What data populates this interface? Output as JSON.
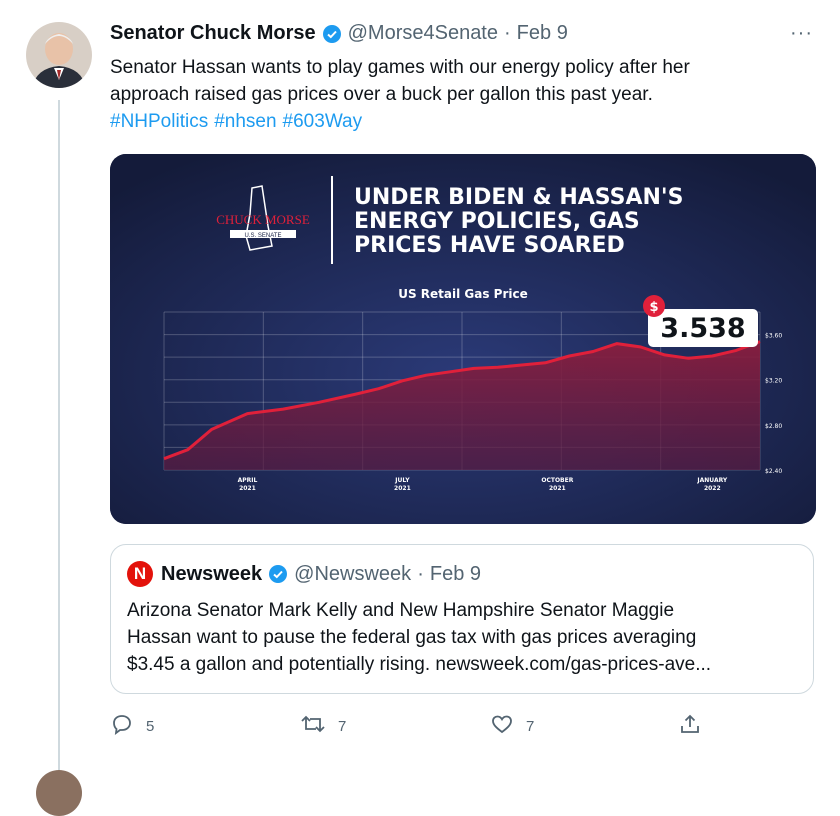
{
  "tweet": {
    "author_name": "Senator Chuck Morse",
    "handle": "@Morse4Senate",
    "separator": "·",
    "date": "Feb 9",
    "more_label": "···",
    "text_line1": "Senator Hassan wants to play games with our energy policy after her",
    "text_line2": "approach raised gas prices over a buck per gallon this past year.",
    "hashtags": [
      "#NHPolitics",
      "#nhsen",
      "#603Way"
    ]
  },
  "graphic": {
    "logo_name": "CHUCK MORSE",
    "logo_sub": "U.S. SENATE",
    "headline_line1": "UNDER BIDEN & HASSAN'S",
    "headline_line2": "ENERGY POLICIES, GAS",
    "headline_line3": "PRICES HAVE SOARED",
    "chart_title": "US Retail Gas Price",
    "callout_symbol": "$",
    "callout_value": "3.538",
    "colors": {
      "background": "#1a2346",
      "line": "#e0203a",
      "fill": "#7a1a3c",
      "headline": "#ffffff"
    }
  },
  "chart_data": {
    "type": "area",
    "title": "US Retail Gas Price",
    "xlabel": "",
    "ylabel": "",
    "x_ticks": [
      {
        "label": "APRIL",
        "sub": "2021"
      },
      {
        "label": "JULY",
        "sub": "2021"
      },
      {
        "label": "OCTOBER",
        "sub": "2021"
      },
      {
        "label": "JANUARY",
        "sub": "2022"
      }
    ],
    "y_ticks": [
      "$3.60",
      "$3.20",
      "$2.80",
      "$2.40"
    ],
    "ylim": [
      2.4,
      3.8
    ],
    "grid": true,
    "x": [
      0,
      4,
      8,
      14,
      20,
      26,
      32,
      36,
      40,
      44,
      48,
      52,
      56,
      60,
      64,
      68,
      72,
      76,
      80,
      84,
      88,
      92,
      96,
      100
    ],
    "values": [
      2.5,
      2.58,
      2.76,
      2.9,
      2.94,
      3.0,
      3.07,
      3.12,
      3.19,
      3.24,
      3.27,
      3.3,
      3.31,
      3.33,
      3.35,
      3.41,
      3.45,
      3.52,
      3.49,
      3.42,
      3.39,
      3.41,
      3.46,
      3.538
    ],
    "series": [
      {
        "name": "",
        "values": [
          2.5,
          2.58,
          2.76,
          2.9,
          2.94,
          3.0,
          3.07,
          3.12,
          3.19,
          3.24,
          3.27,
          3.3,
          3.31,
          3.33,
          3.35,
          3.41,
          3.45,
          3.52,
          3.49,
          3.42,
          3.39,
          3.41,
          3.46,
          3.538
        ]
      }
    ]
  },
  "quote": {
    "logo_letter": "N",
    "author_name": "Newsweek",
    "handle": "@Newsweek",
    "separator": "·",
    "date": "Feb 9",
    "text_line1": "Arizona Senator Mark Kelly and New Hampshire Senator Maggie",
    "text_line2": "Hassan want to pause the federal gas tax with gas prices averaging",
    "text_line3": "$3.45 a gallon and potentially rising. newsweek.com/gas-prices-ave..."
  },
  "actions": {
    "reply_count": "5",
    "retweet_count": "7",
    "like_count": "7"
  },
  "icons": [
    "verified-icon",
    "more-icon",
    "reply-icon",
    "retweet-icon",
    "like-icon",
    "share-icon"
  ]
}
